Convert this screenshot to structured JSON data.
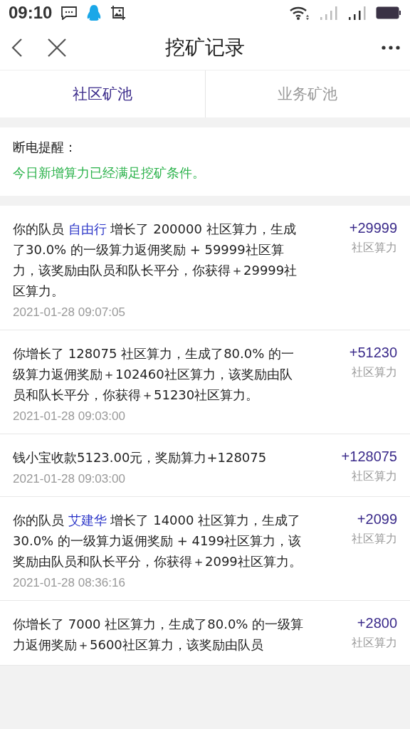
{
  "status_bar": {
    "time": "09:10"
  },
  "header": {
    "title": "挖矿记录"
  },
  "tabs": [
    {
      "label": "社区矿池",
      "selected": true
    },
    {
      "label": "业务矿池",
      "selected": false
    }
  ],
  "notice": {
    "title": "断电提醒：",
    "message": "今日新增算力已经满足挖矿条件。"
  },
  "records": [
    {
      "kind": "member",
      "before": "你的队员 ",
      "member": "自由行",
      "after": " 增长了 200000 社区算力，生成了30.0% 的一级算力返佣奖励 + 59999社区算力，该奖励由队员和队长平分，你获得＋29999社区算力。",
      "time": "2021-01-28 09:07:05",
      "amount": "+29999",
      "unit": "社区算力"
    },
    {
      "kind": "plain",
      "text": "你增长了 128075 社区算力，生成了80.0% 的一级算力返佣奖励＋102460社区算力，该奖励由队员和队长平分，你获得＋51230社区算力。",
      "time": "2021-01-28 09:03:00",
      "amount": "+51230",
      "unit": "社区算力"
    },
    {
      "kind": "plain",
      "text": "钱小宝收款5123.00元，奖励算力+128075",
      "time": "2021-01-28 09:03:00",
      "amount": "+128075",
      "unit": "社区算力"
    },
    {
      "kind": "member",
      "before": "你的队员 ",
      "member": "艾建华",
      "after": " 增长了 14000 社区算力，生成了30.0% 的一级算力返佣奖励 + 4199社区算力，该奖励由队员和队长平分，你获得＋2099社区算力。",
      "time": "2021-01-28 08:36:16",
      "amount": "+2099",
      "unit": "社区算力"
    },
    {
      "kind": "plain",
      "text": "你增长了 7000 社区算力，生成了80.0% 的一级算力返佣奖励＋5600社区算力，该奖励由队员",
      "amount": "+2800",
      "unit": "社区算力"
    }
  ]
}
